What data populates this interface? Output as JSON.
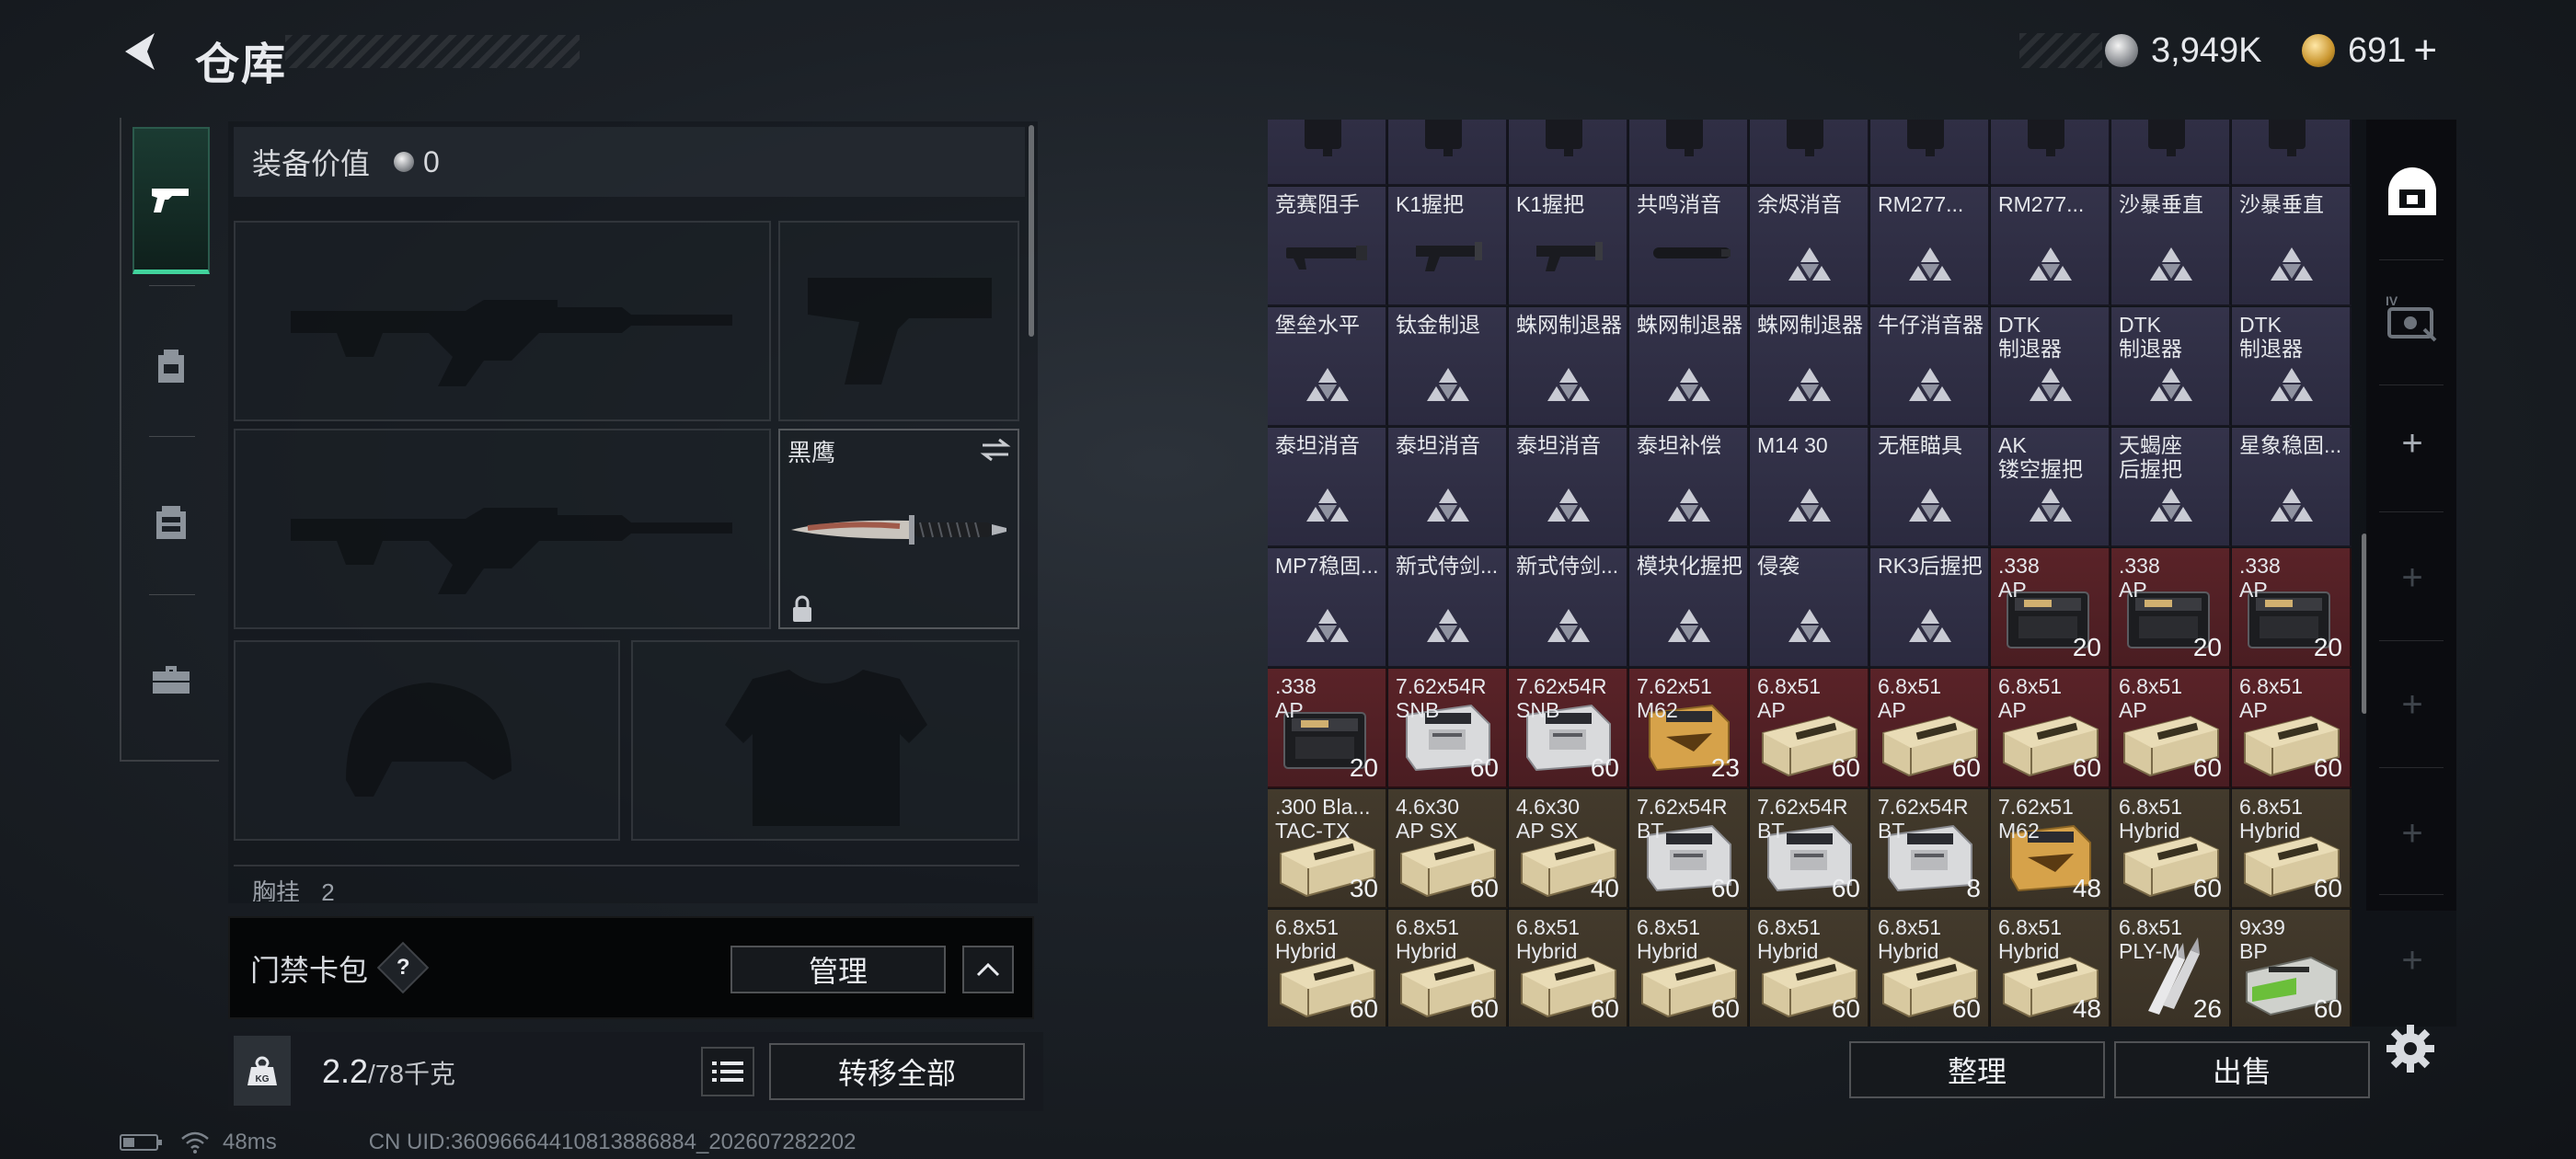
{
  "header": {
    "title": "仓库",
    "currency_silver": "3,949K",
    "currency_gold": "691",
    "gold_plus": "+"
  },
  "nav": {
    "tabs": [
      "weapon-icon",
      "backpack-icon",
      "vest-icon",
      "toolbox-icon"
    ]
  },
  "equipment": {
    "value_label": "装备价值",
    "value": "0",
    "melee_name": "黑鹰",
    "chest_label": "胸挂",
    "chest_count": "2"
  },
  "access_card": {
    "label": "门禁卡包",
    "help": "?",
    "manage_label": "管理"
  },
  "weight": {
    "current": "2.2",
    "max": "/78千克",
    "transfer_all_label": "转移全部"
  },
  "status": {
    "ping": "48ms",
    "uid": "CN UID:36096664410813886884_202607282202"
  },
  "storage": {
    "sort_label": "整理",
    "sell_label": "出售",
    "rows": [
      [
        {
          "name": "",
          "color": "purple",
          "icon": "part"
        },
        {
          "name": "",
          "color": "purple",
          "icon": "part"
        },
        {
          "name": "",
          "color": "purple",
          "icon": "part"
        },
        {
          "name": "",
          "color": "purple",
          "icon": "part"
        },
        {
          "name": "",
          "color": "purple",
          "icon": "part"
        },
        {
          "name": "",
          "color": "purple",
          "icon": "part"
        },
        {
          "name": "",
          "color": "purple",
          "icon": "part"
        },
        {
          "name": "",
          "color": "purple",
          "icon": "part"
        },
        {
          "name": "",
          "color": "purple",
          "icon": "part"
        }
      ],
      [
        {
          "name": "竞赛阻手",
          "color": "purple",
          "icon": "rail"
        },
        {
          "name": "K1握把",
          "color": "purple",
          "icon": "stock"
        },
        {
          "name": "K1握把",
          "color": "purple",
          "icon": "stock"
        },
        {
          "name": "共鸣消音",
          "color": "purple",
          "icon": "suppressor"
        },
        {
          "name": "余烬消音",
          "color": "purple",
          "icon": "delta"
        },
        {
          "name": "RM277...",
          "color": "purple",
          "icon": "delta"
        },
        {
          "name": "RM277...",
          "color": "purple",
          "icon": "delta"
        },
        {
          "name": "沙暴垂直",
          "color": "purple",
          "icon": "delta"
        },
        {
          "name": "沙暴垂直",
          "color": "purple",
          "icon": "delta",
          "flag": true
        }
      ],
      [
        {
          "name": "堡垒水平",
          "color": "purple",
          "icon": "delta"
        },
        {
          "name": "钛金制退",
          "color": "purple",
          "icon": "delta"
        },
        {
          "name": "蛛网制退器",
          "color": "purple",
          "icon": "delta"
        },
        {
          "name": "蛛网制退器",
          "color": "purple",
          "icon": "delta"
        },
        {
          "name": "蛛网制退器",
          "color": "purple",
          "icon": "delta"
        },
        {
          "name": "牛仔消音器",
          "color": "purple",
          "icon": "delta"
        },
        {
          "name": "DTK\n制退器",
          "color": "purple",
          "icon": "delta"
        },
        {
          "name": "DTK\n制退器",
          "color": "purple",
          "icon": "delta"
        },
        {
          "name": "DTK\n制退器",
          "color": "purple",
          "icon": "delta"
        }
      ],
      [
        {
          "name": "泰坦消音",
          "color": "purple",
          "icon": "delta"
        },
        {
          "name": "泰坦消音",
          "color": "purple",
          "icon": "delta"
        },
        {
          "name": "泰坦消音",
          "color": "purple",
          "icon": "delta"
        },
        {
          "name": "泰坦补偿",
          "color": "purple",
          "icon": "delta"
        },
        {
          "name": "M14 30",
          "color": "purple",
          "icon": "delta",
          "flag": true
        },
        {
          "name": "无框瞄具",
          "color": "purple",
          "icon": "delta"
        },
        {
          "name": "AK\n镂空握把",
          "color": "purple",
          "icon": "delta"
        },
        {
          "name": "天蝎座\n后握把",
          "color": "purple",
          "icon": "delta"
        },
        {
          "name": "星象稳固...",
          "color": "purple",
          "icon": "delta"
        }
      ],
      [
        {
          "name": "MP7稳固...",
          "color": "purple",
          "icon": "delta"
        },
        {
          "name": "新式侍剑...",
          "color": "purple",
          "icon": "delta"
        },
        {
          "name": "新式侍剑...",
          "color": "purple",
          "icon": "delta"
        },
        {
          "name": "模块化握把",
          "color": "purple",
          "icon": "delta"
        },
        {
          "name": "侵袭",
          "color": "purple",
          "icon": "delta"
        },
        {
          "name": "RK3后握把",
          "color": "purple",
          "icon": "delta"
        },
        {
          "name": ".338\nAP",
          "color": "red",
          "icon": "ammo-dark",
          "count": "20"
        },
        {
          "name": ".338\nAP",
          "color": "red",
          "icon": "ammo-dark",
          "count": "20"
        },
        {
          "name": ".338\nAP",
          "color": "red",
          "icon": "ammo-dark",
          "count": "20"
        }
      ],
      [
        {
          "name": ".338\nAP",
          "color": "red",
          "icon": "ammo-dark",
          "count": "20"
        },
        {
          "name": "7.62x54R\nSNB",
          "color": "red",
          "icon": "ammo-white",
          "count": "60"
        },
        {
          "name": "7.62x54R\nSNB",
          "color": "red",
          "icon": "ammo-white",
          "count": "60"
        },
        {
          "name": "7.62x51\nM62",
          "color": "red",
          "icon": "ammo-orange",
          "count": "23"
        },
        {
          "name": "6.8x51\nAP",
          "color": "red",
          "icon": "ammo-tan",
          "count": "60"
        },
        {
          "name": "6.8x51\nAP",
          "color": "red",
          "icon": "ammo-tan",
          "count": "60"
        },
        {
          "name": "6.8x51\nAP",
          "color": "red",
          "icon": "ammo-tan",
          "count": "60"
        },
        {
          "name": "6.8x51\nAP",
          "color": "red",
          "icon": "ammo-tan",
          "count": "60"
        },
        {
          "name": "6.8x51\nAP",
          "color": "red",
          "icon": "ammo-tan",
          "count": "60"
        }
      ],
      [
        {
          "name": ".300 Bla...\nTAC-TX",
          "color": "brown",
          "icon": "ammo-tan",
          "count": "30"
        },
        {
          "name": "4.6x30\nAP SX",
          "color": "brown",
          "icon": "ammo-tan",
          "count": "60"
        },
        {
          "name": "4.6x30\nAP SX",
          "color": "brown",
          "icon": "ammo-tan",
          "count": "40"
        },
        {
          "name": "7.62x54R\nBT",
          "color": "brown",
          "icon": "ammo-white",
          "count": "60"
        },
        {
          "name": "7.62x54R\nBT",
          "color": "brown",
          "icon": "ammo-white",
          "count": "60"
        },
        {
          "name": "7.62x54R\nBT",
          "color": "brown",
          "icon": "ammo-white",
          "count": "8"
        },
        {
          "name": "7.62x51\nM62",
          "color": "brown",
          "icon": "ammo-orange",
          "count": "48"
        },
        {
          "name": "6.8x51\nHybrid",
          "color": "brown",
          "icon": "ammo-tan",
          "count": "60"
        },
        {
          "name": "6.8x51\nHybrid",
          "color": "brown",
          "icon": "ammo-tan",
          "count": "60"
        }
      ],
      [
        {
          "name": "6.8x51\nHybrid",
          "color": "brown",
          "icon": "ammo-tan",
          "count": "60"
        },
        {
          "name": "6.8x51\nHybrid",
          "color": "brown",
          "icon": "ammo-tan",
          "count": "60"
        },
        {
          "name": "6.8x51\nHybrid",
          "color": "brown",
          "icon": "ammo-tan",
          "count": "60"
        },
        {
          "name": "6.8x51\nHybrid",
          "color": "brown",
          "icon": "ammo-tan",
          "count": "60"
        },
        {
          "name": "6.8x51\nHybrid",
          "color": "brown",
          "icon": "ammo-tan",
          "count": "60"
        },
        {
          "name": "6.8x51\nHybrid",
          "color": "brown",
          "icon": "ammo-tan",
          "count": "60"
        },
        {
          "name": "6.8x51\nHybrid",
          "color": "brown",
          "icon": "ammo-tan",
          "count": "48"
        },
        {
          "name": "6.8x51\nPLY-M",
          "color": "brown",
          "icon": "ammo-bullets",
          "count": "26"
        },
        {
          "name": "9x39\nBP",
          "color": "brown",
          "icon": "ammo-green",
          "count": "60"
        }
      ]
    ]
  },
  "rail": {
    "items": [
      "safebox-icon",
      "iv-case-icon",
      "add-icon",
      "add-icon",
      "add-icon",
      "add-icon",
      "add-icon"
    ]
  }
}
